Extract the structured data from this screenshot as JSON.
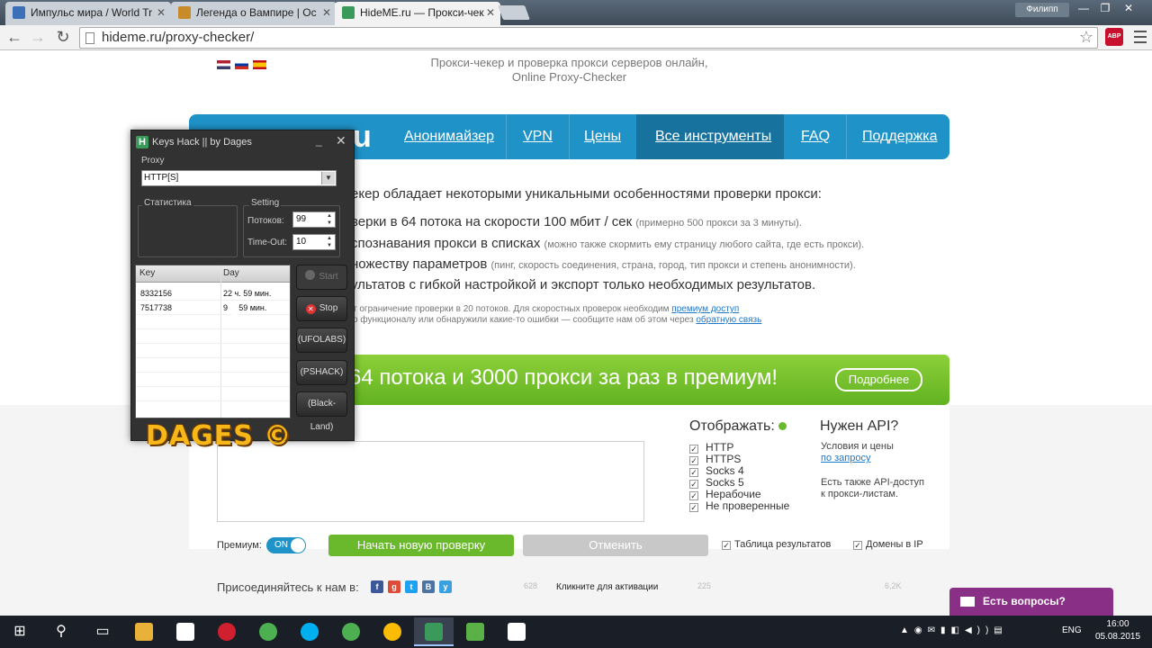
{
  "browser": {
    "tabs": [
      {
        "title": "Импульс мира / World Tr",
        "icon_color": "#3b6fb8"
      },
      {
        "title": "Легенда о Вампире | Ос",
        "icon_color": "#c98b2a"
      },
      {
        "title": "HideME.ru — Прокси-чек",
        "icon_color": "#3a9a5a"
      }
    ],
    "profile_name": "Филипп",
    "url": "hideme.ru/proxy-checker/",
    "abp_label": "ABP"
  },
  "site": {
    "subtitle_line1": "Прокси-чекер и проверка прокси серверов онлайн,",
    "subtitle_line2": "Online Proxy-Checker",
    "logo_fragment": "u",
    "nav": [
      "Анонимайзер",
      "VPN",
      "Цены",
      "Все инструменты",
      "FAQ",
      "Поддержка"
    ],
    "features_heading": "екер обладает некоторыми уникальными особенностями проверки прокси:",
    "features": [
      {
        "main": "верки в 64 потока на скорости 100 мбит / сек",
        "note": "(примерно 500 прокси за 3 минуты)."
      },
      {
        "main": "спознавания прокси в списках",
        "note": "(можно также скормить ему страницу любого сайта, где есть прокси)."
      },
      {
        "main": "ножеству параметров",
        "note": "(пинг, скорость соединения, страна, город, тип прокси и степень анонимности)."
      },
      {
        "main": "ультатов с гибкой настройкой и экспорт только необходимых результатов.",
        "note": ""
      }
    ],
    "note1_text": "т ограничение проверки в 20 потоков. Для скоростных проверок необходим",
    "note1_link": "премиум доступ",
    "note2_text": "о функционалу или обнаружили какие-то ошибки — сообщите нам об этом через",
    "note2_link": "обратную связь",
    "banner_text": "64 потока и 3000 прокси за раз в премиум!",
    "banner_button": "Подробнее",
    "display_title": "Отображать:",
    "display_options": [
      "HTTP",
      "HTTPS",
      "Socks 4",
      "Socks 5",
      "Нерабочие",
      "Не проверенные"
    ],
    "api_title": "Нужен API?",
    "api_line1": "Условия и цены",
    "api_link": "по запросу",
    "api_line3": "Есть также API-доступ",
    "api_line4": "к прокси-листам.",
    "premium_label": "Премиум:",
    "premium_toggle": "ON",
    "start_check": "Начать новую проверку",
    "cancel": "Отменить",
    "results_table": "Таблица результатов",
    "ip_domains": "Домены в IP",
    "join_us": "Присоединяйтесь к нам в:",
    "social": [
      {
        "letter": "f",
        "color": "#3b5998"
      },
      {
        "letter": "g",
        "color": "#dd4b39"
      },
      {
        "letter": "t",
        "color": "#1da1f2"
      },
      {
        "letter": "B",
        "color": "#4c75a3"
      },
      {
        "letter": "y",
        "color": "#3aa0e0"
      }
    ],
    "likes_count": "628",
    "activation_text": "Кликните для активации",
    "shares_count": "225",
    "share_total": "6,2K",
    "chat_label": "Есть вопросы?"
  },
  "app": {
    "title": "Keys Hack || by Dages",
    "proxy_label": "Proxy",
    "proxy_value": "HTTP[S]",
    "stats_label": "Статистика",
    "setting_label": "Setting",
    "threads_label": "Потоков:",
    "threads_value": "99",
    "timeout_label": "Time-Out:",
    "timeout_value": "10",
    "col_key": "Key",
    "col_day": "Day",
    "rows": [
      {
        "key": "8332156",
        "day": "22 ч. 59 мин."
      },
      {
        "key": "7517738",
        "day": "9 ч. 59 мин."
      }
    ],
    "buttons": {
      "start": "Start",
      "stop": "Stop",
      "ufolabs": "(UFOLABS)",
      "pshack": "(PSHACK)",
      "blackland": "(Black-Land)"
    },
    "brand": "DAGES"
  },
  "taskbar": {
    "apps": [
      {
        "name": "file-explorer",
        "color": "#e8b23a"
      },
      {
        "name": "store",
        "color": "#ffffff"
      },
      {
        "name": "opera",
        "color": "#d01f2f"
      },
      {
        "name": "chrome-1",
        "color": "#4caf50"
      },
      {
        "name": "skype",
        "color": "#00aff0"
      },
      {
        "name": "chrome-2",
        "color": "#4caf50"
      },
      {
        "name": "chrome-3",
        "color": "#fbbc05"
      },
      {
        "name": "keys-hack",
        "color": "#3a9a5a"
      },
      {
        "name": "camtasia",
        "color": "#5ab246"
      },
      {
        "name": "camtasia-2",
        "color": "#ffffff"
      }
    ],
    "lang": "ENG",
    "time": "16:00",
    "date": "05.08.2015"
  }
}
